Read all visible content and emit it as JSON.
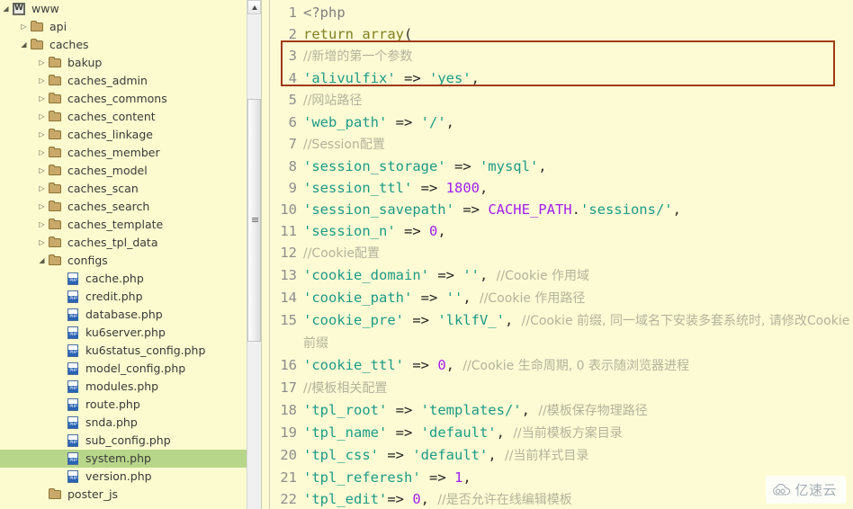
{
  "sidebar": {
    "scroll": {
      "up_arrow_icon": "scroll-up-arrow-icon",
      "grip_icon": "scrollbar-grip-icon"
    },
    "items": [
      {
        "label": "www",
        "depth": 0,
        "icon": "www-icon",
        "state": "expanded",
        "selected": false
      },
      {
        "label": "api",
        "depth": 1,
        "icon": "folder-icon",
        "state": "collapsed",
        "selected": false
      },
      {
        "label": "caches",
        "depth": 1,
        "icon": "folder-icon",
        "state": "expanded",
        "selected": false
      },
      {
        "label": "bakup",
        "depth": 2,
        "icon": "folder-icon",
        "state": "collapsed",
        "selected": false
      },
      {
        "label": "caches_admin",
        "depth": 2,
        "icon": "folder-icon",
        "state": "collapsed",
        "selected": false
      },
      {
        "label": "caches_commons",
        "depth": 2,
        "icon": "folder-icon",
        "state": "collapsed",
        "selected": false
      },
      {
        "label": "caches_content",
        "depth": 2,
        "icon": "folder-icon",
        "state": "collapsed",
        "selected": false
      },
      {
        "label": "caches_linkage",
        "depth": 2,
        "icon": "folder-icon",
        "state": "collapsed",
        "selected": false
      },
      {
        "label": "caches_member",
        "depth": 2,
        "icon": "folder-icon",
        "state": "collapsed",
        "selected": false
      },
      {
        "label": "caches_model",
        "depth": 2,
        "icon": "folder-icon",
        "state": "collapsed",
        "selected": false
      },
      {
        "label": "caches_scan",
        "depth": 2,
        "icon": "folder-icon",
        "state": "collapsed",
        "selected": false
      },
      {
        "label": "caches_search",
        "depth": 2,
        "icon": "folder-icon",
        "state": "collapsed",
        "selected": false
      },
      {
        "label": "caches_template",
        "depth": 2,
        "icon": "folder-icon",
        "state": "collapsed",
        "selected": false
      },
      {
        "label": "caches_tpl_data",
        "depth": 2,
        "icon": "folder-icon",
        "state": "collapsed",
        "selected": false
      },
      {
        "label": "configs",
        "depth": 2,
        "icon": "folder-icon",
        "state": "expanded",
        "selected": false
      },
      {
        "label": "cache.php",
        "depth": 3,
        "icon": "php-file-icon",
        "state": "none",
        "selected": false
      },
      {
        "label": "credit.php",
        "depth": 3,
        "icon": "php-file-icon",
        "state": "none",
        "selected": false
      },
      {
        "label": "database.php",
        "depth": 3,
        "icon": "php-file-icon",
        "state": "none",
        "selected": false
      },
      {
        "label": "ku6server.php",
        "depth": 3,
        "icon": "php-file-icon",
        "state": "none",
        "selected": false
      },
      {
        "label": "ku6status_config.php",
        "depth": 3,
        "icon": "php-file-icon",
        "state": "none",
        "selected": false
      },
      {
        "label": "model_config.php",
        "depth": 3,
        "icon": "php-file-icon",
        "state": "none",
        "selected": false
      },
      {
        "label": "modules.php",
        "depth": 3,
        "icon": "php-file-icon",
        "state": "none",
        "selected": false
      },
      {
        "label": "route.php",
        "depth": 3,
        "icon": "php-file-icon",
        "state": "none",
        "selected": false
      },
      {
        "label": "snda.php",
        "depth": 3,
        "icon": "php-file-icon",
        "state": "none",
        "selected": false
      },
      {
        "label": "sub_config.php",
        "depth": 3,
        "icon": "php-file-icon",
        "state": "none",
        "selected": false
      },
      {
        "label": "system.php",
        "depth": 3,
        "icon": "php-file-icon",
        "state": "none",
        "selected": true
      },
      {
        "label": "version.php",
        "depth": 3,
        "icon": "php-file-icon",
        "state": "none",
        "selected": false
      },
      {
        "label": "poster_js",
        "depth": 2,
        "icon": "folder-icon",
        "state": "none",
        "selected": false
      }
    ]
  },
  "editor": {
    "lines": [
      {
        "num": "1",
        "tokens": [
          {
            "t": "<?php",
            "c": "tag"
          }
        ]
      },
      {
        "num": "2",
        "tokens": [
          {
            "t": "return ",
            "c": "kw"
          },
          {
            "t": "array",
            "c": "kw"
          },
          {
            "t": "(",
            "c": "plain"
          }
        ]
      },
      {
        "num": "3",
        "tokens": [
          {
            "t": "//新增的第一个参数",
            "c": "com"
          }
        ]
      },
      {
        "num": "4",
        "tokens": [
          {
            "t": "'alivulfix'",
            "c": "str"
          },
          {
            "t": " => ",
            "c": "op"
          },
          {
            "t": "'yes'",
            "c": "str"
          },
          {
            "t": ",",
            "c": "plain"
          }
        ]
      },
      {
        "num": "5",
        "tokens": [
          {
            "t": "//网站路径",
            "c": "com"
          }
        ]
      },
      {
        "num": "6",
        "tokens": [
          {
            "t": "'web_path'",
            "c": "str"
          },
          {
            "t": " => ",
            "c": "op"
          },
          {
            "t": "'/'",
            "c": "str"
          },
          {
            "t": ",",
            "c": "plain"
          }
        ]
      },
      {
        "num": "7",
        "tokens": [
          {
            "t": "//Session配置",
            "c": "com"
          }
        ]
      },
      {
        "num": "8",
        "tokens": [
          {
            "t": "'session_storage'",
            "c": "str"
          },
          {
            "t": " => ",
            "c": "op"
          },
          {
            "t": "'mysql'",
            "c": "str"
          },
          {
            "t": ",",
            "c": "plain"
          }
        ]
      },
      {
        "num": "9",
        "tokens": [
          {
            "t": "'session_ttl'",
            "c": "str"
          },
          {
            "t": " => ",
            "c": "op"
          },
          {
            "t": "1800",
            "c": "num"
          },
          {
            "t": ",",
            "c": "plain"
          }
        ]
      },
      {
        "num": "10",
        "tokens": [
          {
            "t": "'session_savepath'",
            "c": "str"
          },
          {
            "t": " => ",
            "c": "op"
          },
          {
            "t": "CACHE_PATH",
            "c": "const"
          },
          {
            "t": ".",
            "c": "plain"
          },
          {
            "t": "'sessions/'",
            "c": "str"
          },
          {
            "t": ",",
            "c": "plain"
          }
        ]
      },
      {
        "num": "11",
        "tokens": [
          {
            "t": "'session_n'",
            "c": "str"
          },
          {
            "t": " => ",
            "c": "op"
          },
          {
            "t": "0",
            "c": "num"
          },
          {
            "t": ",",
            "c": "plain"
          }
        ]
      },
      {
        "num": "12",
        "tokens": [
          {
            "t": "//Cookie配置",
            "c": "com"
          }
        ]
      },
      {
        "num": "13",
        "tokens": [
          {
            "t": "'cookie_domain'",
            "c": "str"
          },
          {
            "t": " => ",
            "c": "op"
          },
          {
            "t": "''",
            "c": "str"
          },
          {
            "t": ", ",
            "c": "plain"
          },
          {
            "t": "//Cookie 作用域",
            "c": "com"
          }
        ]
      },
      {
        "num": "14",
        "tokens": [
          {
            "t": "'cookie_path'",
            "c": "str"
          },
          {
            "t": " => ",
            "c": "op"
          },
          {
            "t": "''",
            "c": "str"
          },
          {
            "t": ", ",
            "c": "plain"
          },
          {
            "t": "//Cookie 作用路径",
            "c": "com"
          }
        ]
      },
      {
        "num": "15",
        "tokens": [
          {
            "t": "'cookie_pre'",
            "c": "str"
          },
          {
            "t": " => ",
            "c": "op"
          },
          {
            "t": "'lklfV_'",
            "c": "str"
          },
          {
            "t": ", ",
            "c": "plain"
          },
          {
            "t": "//Cookie 前缀, 同一域名下安装多套系统时, 请修改Cookie前缀",
            "c": "com"
          }
        ]
      },
      {
        "num": "16",
        "tokens": [
          {
            "t": "'cookie_ttl'",
            "c": "str"
          },
          {
            "t": " => ",
            "c": "op"
          },
          {
            "t": "0",
            "c": "num"
          },
          {
            "t": ", ",
            "c": "plain"
          },
          {
            "t": "//Cookie 生命周期, 0 表示随浏览器进程",
            "c": "com"
          }
        ]
      },
      {
        "num": "17",
        "tokens": [
          {
            "t": "//模板相关配置",
            "c": "com"
          }
        ]
      },
      {
        "num": "18",
        "tokens": [
          {
            "t": "'tpl_root'",
            "c": "str"
          },
          {
            "t": " => ",
            "c": "op"
          },
          {
            "t": "'templates/'",
            "c": "str"
          },
          {
            "t": ", ",
            "c": "plain"
          },
          {
            "t": "//模板保存物理路径",
            "c": "com"
          }
        ]
      },
      {
        "num": "19",
        "tokens": [
          {
            "t": "'tpl_name'",
            "c": "str"
          },
          {
            "t": " => ",
            "c": "op"
          },
          {
            "t": "'default'",
            "c": "str"
          },
          {
            "t": ", ",
            "c": "plain"
          },
          {
            "t": "//当前模板方案目录",
            "c": "com"
          }
        ]
      },
      {
        "num": "20",
        "tokens": [
          {
            "t": "'tpl_css'",
            "c": "str"
          },
          {
            "t": " => ",
            "c": "op"
          },
          {
            "t": "'default'",
            "c": "str"
          },
          {
            "t": ", ",
            "c": "plain"
          },
          {
            "t": "//当前样式目录",
            "c": "com"
          }
        ]
      },
      {
        "num": "21",
        "tokens": [
          {
            "t": "'tpl_referesh'",
            "c": "str"
          },
          {
            "t": " => ",
            "c": "op"
          },
          {
            "t": "1",
            "c": "num"
          },
          {
            "t": ",",
            "c": "plain"
          }
        ]
      },
      {
        "num": "22",
        "tokens": [
          {
            "t": "'tpl_edit'",
            "c": "str"
          },
          {
            "t": "=> ",
            "c": "op"
          },
          {
            "t": "0",
            "c": "num"
          },
          {
            "t": ", ",
            "c": "plain"
          },
          {
            "t": "//是否允许在线编辑模板",
            "c": "com"
          }
        ]
      }
    ],
    "annotation": {
      "name": "red-highlight-box",
      "color": "#a03a16",
      "lines": [
        "3",
        "4"
      ]
    }
  },
  "watermark": {
    "text": "亿速云",
    "icon": "cloud-icon"
  }
}
